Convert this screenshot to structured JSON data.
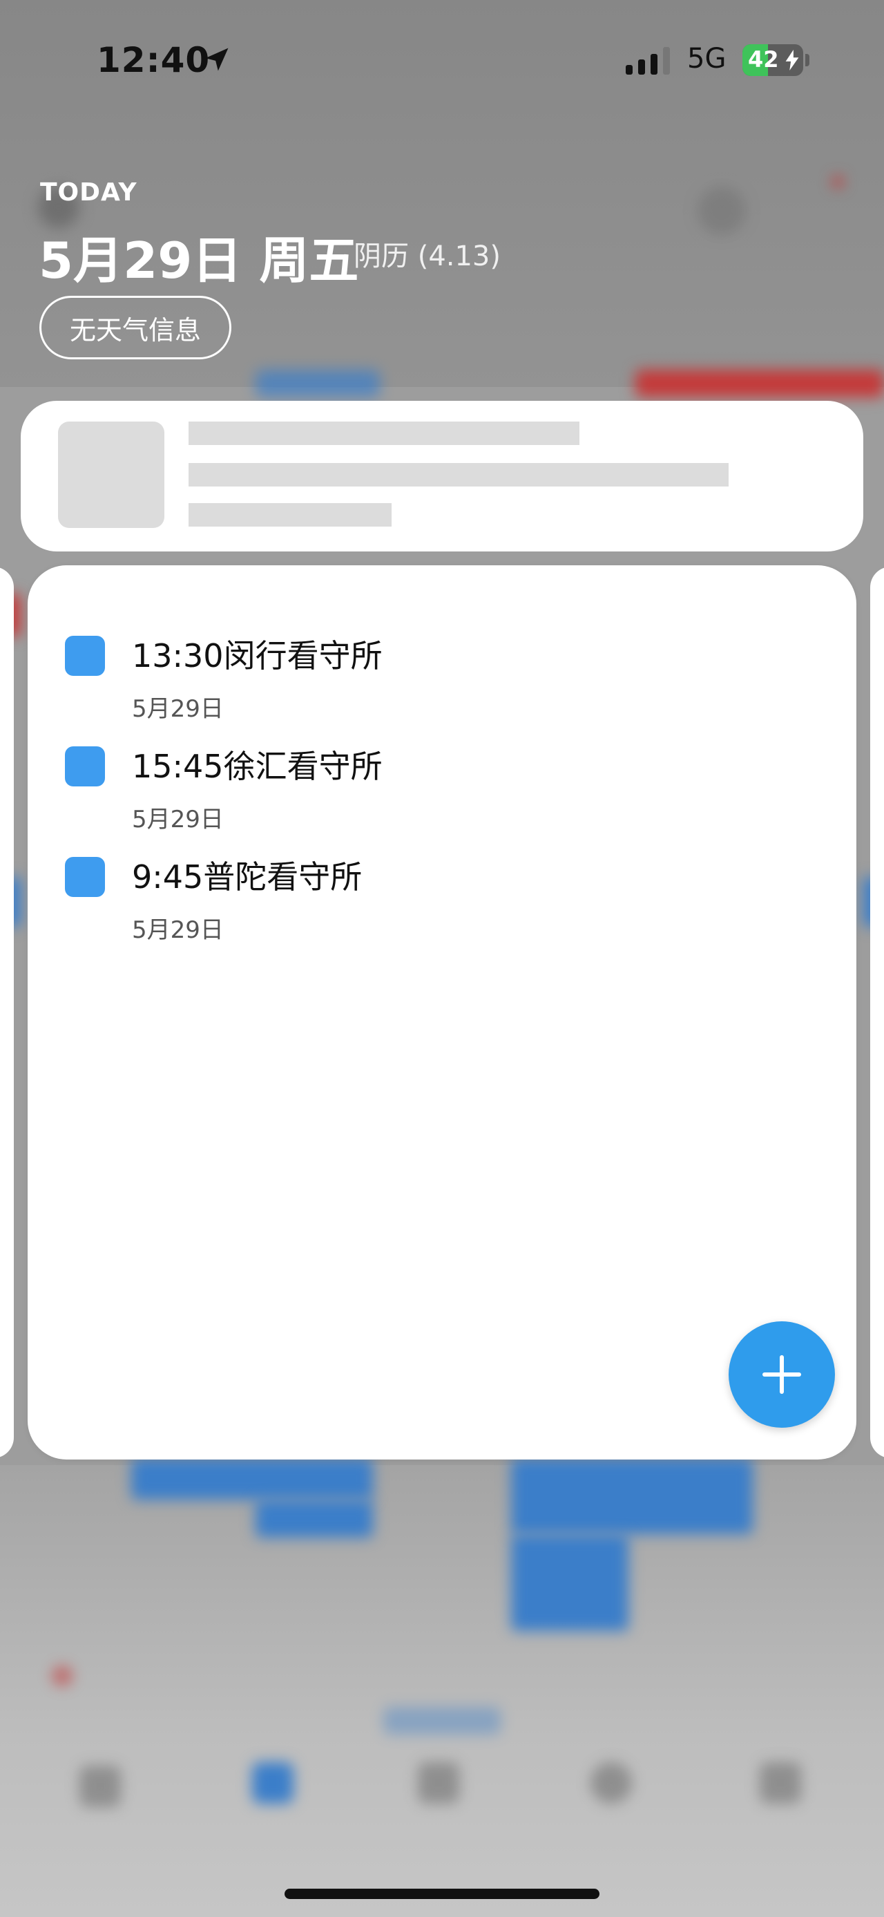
{
  "status_bar": {
    "time": "12:40",
    "network": "5G",
    "battery_percent": "42",
    "battery_level": 0.42,
    "icons": [
      "location-arrow-icon",
      "signal-bars-icon",
      "charging-bolt-icon"
    ]
  },
  "widget": {
    "today_label": "TODAY",
    "date_title": "5月29日 周五",
    "lunar_date": "阴历 (4.13)",
    "weather": "无天气信息"
  },
  "events": [
    {
      "title": "13:30闵行看守所",
      "date": "5月29日"
    },
    {
      "title": "15:45徐汇看守所",
      "date": "5月29日"
    },
    {
      "title": "9:45普陀看守所",
      "date": "5月29日"
    }
  ],
  "fab": {
    "icon": "plus-icon"
  },
  "colors": {
    "accent": "#2f9cec",
    "checkbox": "#3e9cef",
    "battery": "#3fc35a"
  }
}
